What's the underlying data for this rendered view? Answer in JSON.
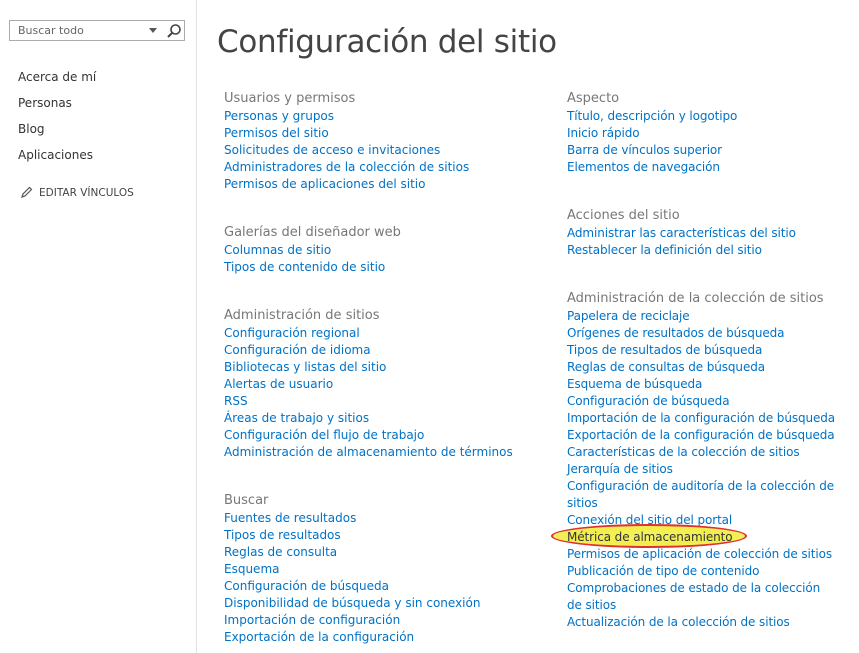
{
  "search": {
    "placeholder": "Buscar todo"
  },
  "sidebar": {
    "items": [
      {
        "label": "Acerca de mí"
      },
      {
        "label": "Personas"
      },
      {
        "label": "Blog"
      },
      {
        "label": "Aplicaciones"
      }
    ],
    "edit_links": "EDITAR VÍNCULOS"
  },
  "page_title": "Configuración del sitio",
  "colors": {
    "link": "#0072c6",
    "heading": "#777777",
    "highlight": "#f2ee47",
    "highlight_border": "#e03030"
  },
  "left_column": [
    {
      "heading": "Usuarios y permisos",
      "links": [
        "Personas y grupos",
        "Permisos del sitio",
        "Solicitudes de acceso e invitaciones",
        "Administradores de la colección de sitios",
        "Permisos de aplicaciones del sitio"
      ]
    },
    {
      "heading": "Galerías del diseñador web",
      "links": [
        "Columnas de sitio",
        "Tipos de contenido de sitio"
      ]
    },
    {
      "heading": "Administración de sitios",
      "links": [
        "Configuración regional",
        "Configuración de idioma",
        "Bibliotecas y listas del sitio",
        "Alertas de usuario",
        "RSS",
        "Áreas de trabajo y sitios",
        "Configuración del flujo de trabajo",
        "Administración de almacenamiento de términos"
      ]
    },
    {
      "heading": "Buscar",
      "links": [
        "Fuentes de resultados",
        "Tipos de resultados",
        "Reglas de consulta",
        "Esquema",
        "Configuración de búsqueda",
        "Disponibilidad de búsqueda y sin conexión",
        "Importación de configuración",
        "Exportación de la configuración"
      ]
    }
  ],
  "right_column": [
    {
      "heading": "Aspecto",
      "links": [
        "Título, descripción y logotipo",
        "Inicio rápido",
        "Barra de vínculos superior",
        "Elementos de navegación"
      ]
    },
    {
      "heading": "Acciones del sitio",
      "links": [
        "Administrar las características del sitio",
        "Restablecer la definición del sitio"
      ]
    },
    {
      "heading": "Administración de la colección de sitios",
      "links": [
        "Papelera de reciclaje",
        "Orígenes de resultados de búsqueda",
        "Tipos de resultados de búsqueda",
        "Reglas de consultas de búsqueda",
        "Esquema de búsqueda",
        "Configuración de búsqueda",
        "Importación de la configuración de búsqueda",
        "Exportación de la configuración de búsqueda",
        "Características de la colección de sitios",
        "Jerarquía de sitios",
        "Configuración de auditoría de la colección de sitios",
        "Conexión del sitio del portal",
        "Métrica de almacenamiento",
        "Permisos de aplicación de colección de sitios",
        "Publicación de tipo de contenido",
        "Comprobaciones de estado de la colección de sitios",
        "Actualización de la colección de sitios"
      ]
    }
  ]
}
